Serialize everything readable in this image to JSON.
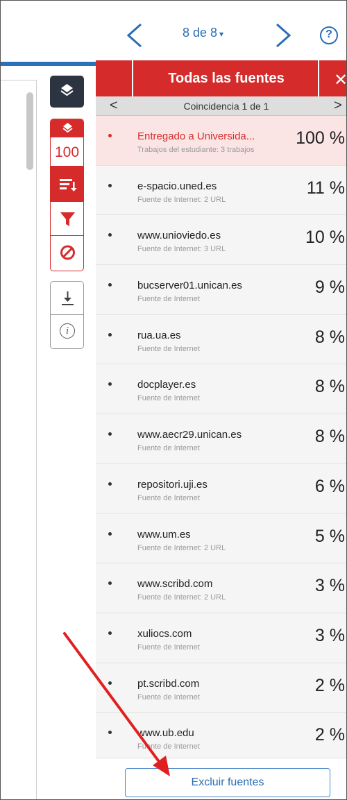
{
  "nav": {
    "page_label": "8 de 8",
    "caret": "▾",
    "help": "?"
  },
  "toolbar": {
    "similarity_score": "100"
  },
  "sources_panel": {
    "title": "Todas las fuentes",
    "close": "✕",
    "match_text": "Coincidencia 1 de 1",
    "match_prev": "<",
    "match_next": ">",
    "items": [
      {
        "name": "Entregado a Universida...",
        "sub": "Trabajos del estudiante: 3 trabajos",
        "pct": "100 %"
      },
      {
        "name": "e-spacio.uned.es",
        "sub": "Fuente de Internet: 2 URL",
        "pct": "11 %"
      },
      {
        "name": "www.unioviedo.es",
        "sub": "Fuente de Internet: 3 URL",
        "pct": "10 %"
      },
      {
        "name": "bucserver01.unican.es",
        "sub": "Fuente de Internet",
        "pct": "9 %"
      },
      {
        "name": "rua.ua.es",
        "sub": "Fuente de Internet",
        "pct": "8 %"
      },
      {
        "name": "docplayer.es",
        "sub": "Fuente de Internet",
        "pct": "8 %"
      },
      {
        "name": "www.aecr29.unican.es",
        "sub": "Fuente de Internet",
        "pct": "8 %"
      },
      {
        "name": "repositori.uji.es",
        "sub": "Fuente de Internet",
        "pct": "6 %"
      },
      {
        "name": "www.um.es",
        "sub": "Fuente de Internet: 2 URL",
        "pct": "5 %"
      },
      {
        "name": "www.scribd.com",
        "sub": "Fuente de Internet: 2 URL",
        "pct": "3 %"
      },
      {
        "name": "xuliocs.com",
        "sub": "Fuente de Internet",
        "pct": "3 %"
      },
      {
        "name": "pt.scribd.com",
        "sub": "Fuente de Internet",
        "pct": "2 %"
      },
      {
        "name": "www.ub.edu",
        "sub": "Fuente de Internet",
        "pct": "2 %"
      }
    ],
    "exclude_button": "Excluir fuentes"
  },
  "colors": {
    "accent_red": "#d62b2b",
    "accent_blue": "#2a6db5",
    "annotation_arrow": "#e02020"
  }
}
